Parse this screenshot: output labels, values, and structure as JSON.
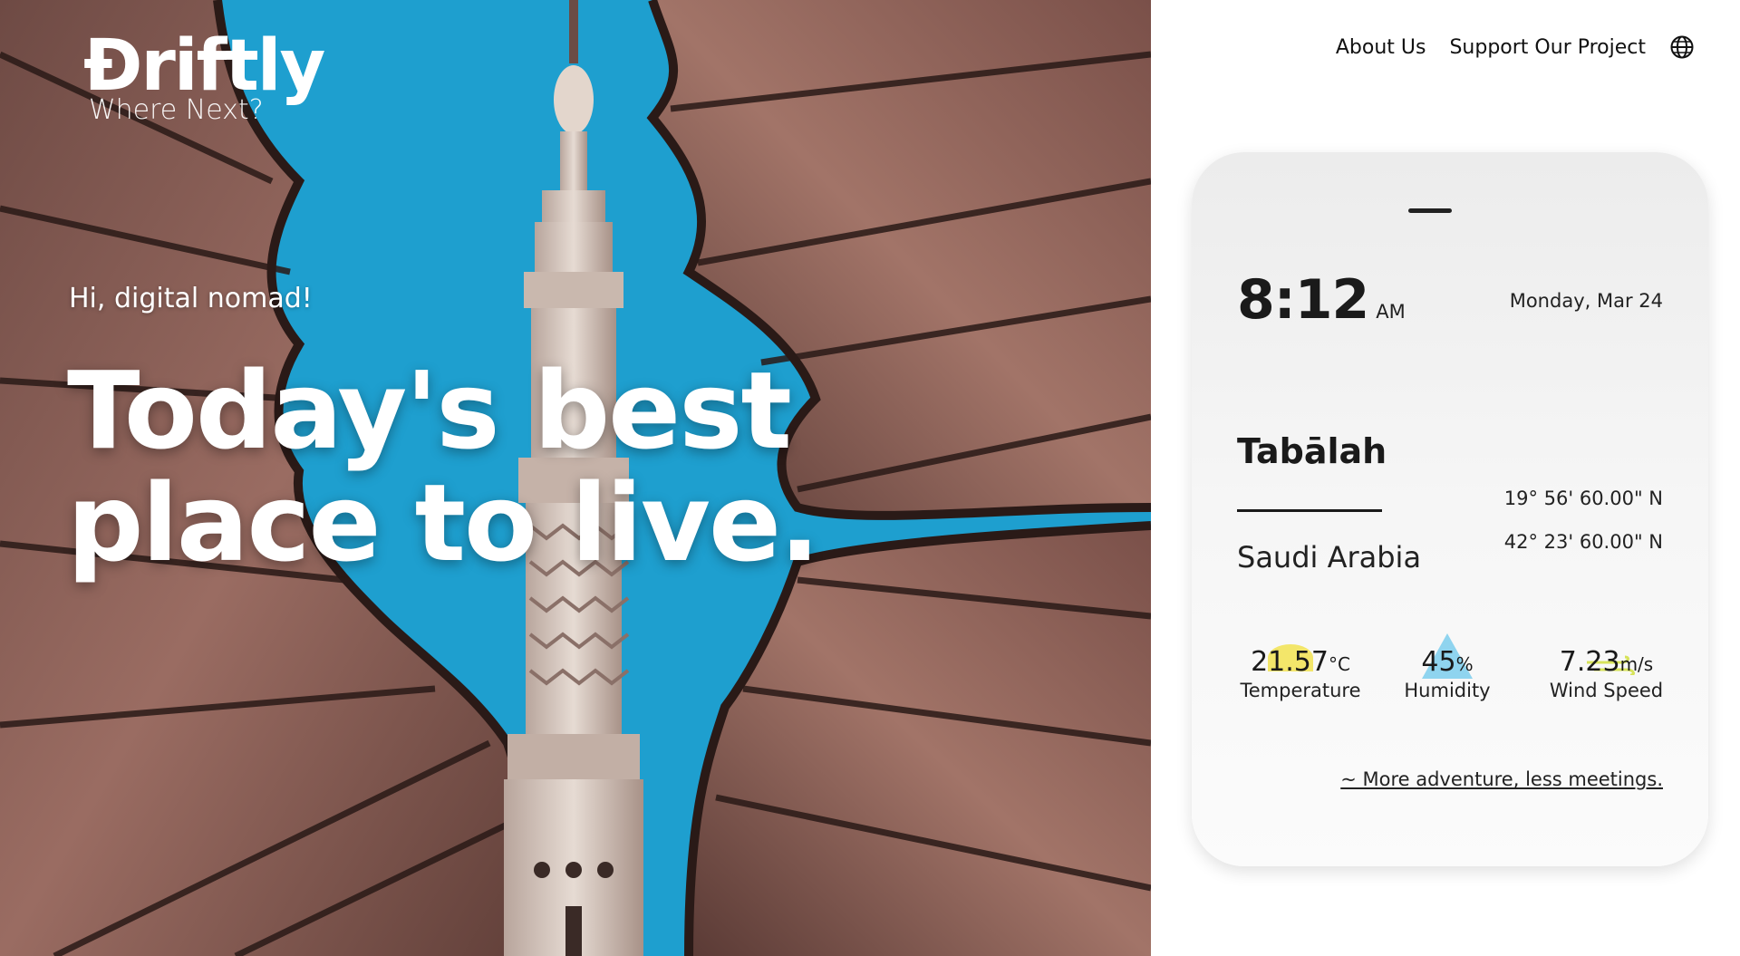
{
  "brand": {
    "name": "Ɖriftly",
    "tagline": "Where Next?"
  },
  "hero": {
    "greeting": "Hi, digital nomad!",
    "headline_line1": "Today's best",
    "headline_line2": "place to live."
  },
  "nav": {
    "items": [
      {
        "label": "About Us"
      },
      {
        "label": "Support Our Project"
      }
    ],
    "language_icon": "globe-icon"
  },
  "card": {
    "time": "8:12",
    "ampm": "AM",
    "date": "Monday, Mar 24",
    "city": "Tabālah",
    "country": "Saudi Arabia",
    "latitude": "19° 56' 60.00\" N",
    "longitude": "42° 23' 60.00\" N",
    "stats": {
      "temperature": {
        "value": "21.57",
        "unit": "°C",
        "label": "Temperature",
        "icon": "sun-icon"
      },
      "humidity": {
        "value": "45",
        "unit": "%",
        "label": "Humidity",
        "icon": "drop-icon"
      },
      "wind": {
        "value": "7.23",
        "unit": "m/s",
        "label": "Wind Speed",
        "icon": "wind-icon"
      }
    },
    "footer_link": "~ More adventure, less meetings."
  },
  "colors": {
    "sky": "#1e9fcf",
    "canopy": "#8a5a50",
    "canopy_dark": "#3a2622",
    "text_dark": "#1a1a1a",
    "card_bg": "#f2f2f2",
    "sun_accent": "#f2e35a",
    "drop_accent": "#8fd4ef",
    "wind_accent": "#d7e35a"
  }
}
